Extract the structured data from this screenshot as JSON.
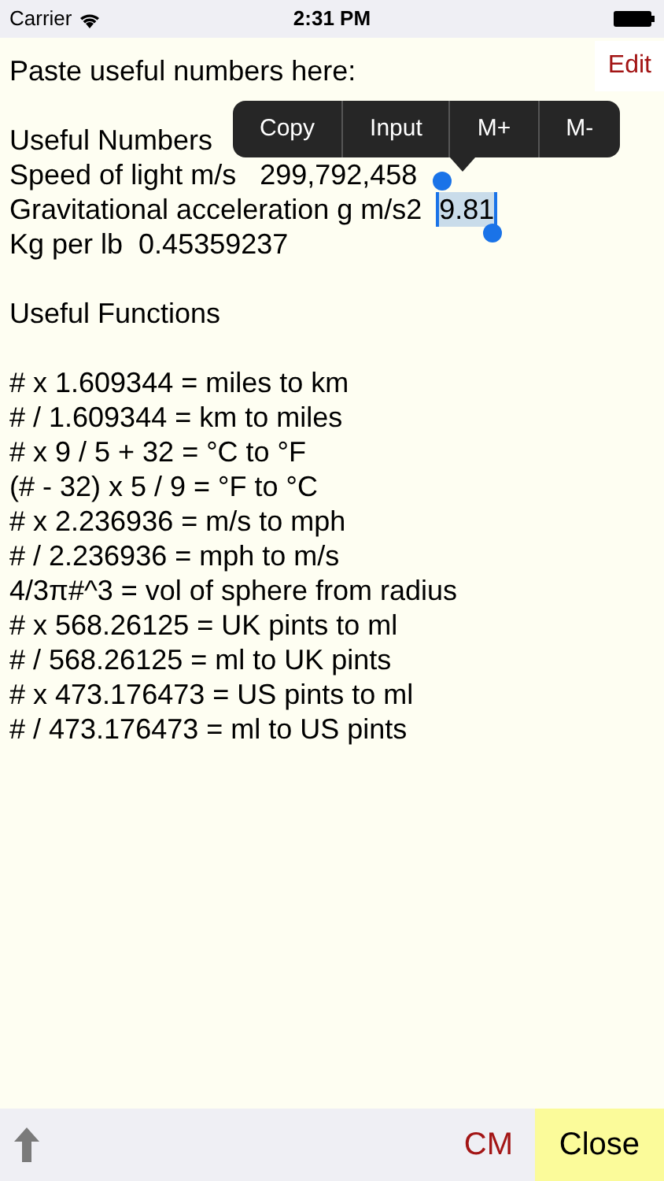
{
  "status_bar": {
    "carrier": "Carrier",
    "time": "2:31 PM"
  },
  "edit_button": "Edit",
  "paragraphs": [
    [
      {
        "text": "Paste useful numbers here:"
      }
    ],
    [
      {
        "text": "Useful Numbers"
      },
      {
        "text": "Speed of light m/s   299,792,458"
      },
      {
        "text": "Gravitational acceleration g m/s2",
        "selection": "9.81"
      },
      {
        "text": "Kg per lb  0.45359237"
      }
    ],
    [
      {
        "text": "Useful Functions"
      }
    ],
    [
      {
        "text": "# x 1.609344 = miles to km"
      },
      {
        "text": "# / 1.609344 = km to miles"
      },
      {
        "text": "# x 9 / 5 + 32 = °C to °F"
      },
      {
        "text": "(# - 32) x 5 / 9 = °F to °C"
      },
      {
        "text": "# x 2.236936 = m/s to mph"
      },
      {
        "text": "# / 2.236936 = mph to m/s"
      },
      {
        "text": "4/3π#^3 = vol of sphere from radius"
      },
      {
        "text": "# x 568.26125 = UK pints to ml"
      },
      {
        "text": "# / 568.26125 = ml to UK pints"
      },
      {
        "text": "# x 473.176473 = US pints to ml"
      },
      {
        "text": "# / 473.176473 = ml to US pints"
      }
    ]
  ],
  "context_menu": [
    "Copy",
    "Input",
    "M+",
    "M-"
  ],
  "toolbar": {
    "cm_button": "CM",
    "close_button": "Close"
  }
}
